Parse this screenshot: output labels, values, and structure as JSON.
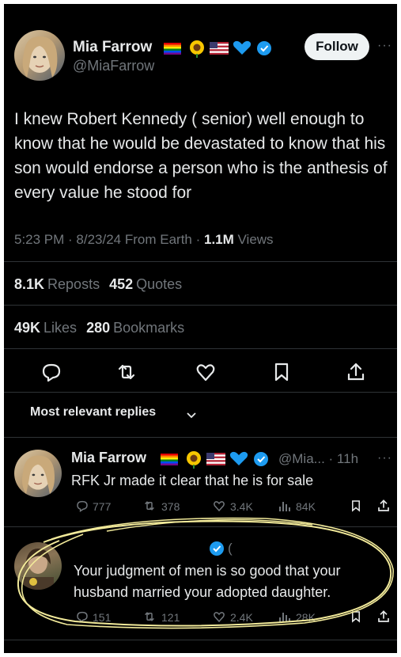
{
  "tweet": {
    "author_name": "Mia Farrow",
    "author_handle": "@MiaFarrow",
    "follow_label": "Follow",
    "more_label": "···",
    "text": "I knew Robert Kennedy ( senior) well enough to know that he would be devastated to know that his son would endorse a person who is the anthesis of every value he stood for",
    "timestamp": "5:23 PM · 8/23/24 From Earth · ",
    "views_count": "1.1M",
    "views_label": " Views",
    "reposts_count": "8.1K",
    "reposts_label": "Reposts",
    "quotes_count": "452",
    "quotes_label": "Quotes",
    "likes_count": "49K",
    "likes_label": "Likes",
    "bookmarks_count": "280",
    "bookmarks_label": "Bookmarks"
  },
  "replies_sort": {
    "label": "Most relevant replies"
  },
  "replies": [
    {
      "author_name": "Mia Farrow",
      "handle_time": "@Mia... · 11h",
      "more_label": "···",
      "text": "RFK Jr made it clear that he is for sale",
      "comments": "777",
      "reposts": "378",
      "likes": "3.4K",
      "views": "84K"
    },
    {
      "author_suffix": "(",
      "text_line1": "Your judgment of men is so good that your",
      "text_line2": "husband married your adopted daughter.",
      "comments": "151",
      "reposts": "121",
      "likes": "2.4K",
      "views": "28K"
    }
  ],
  "colors": {
    "background": "#000000",
    "text": "#e7e9ea",
    "muted": "#71767b",
    "verified": "#1d9bf0",
    "annotation": "#f2ea9a"
  }
}
